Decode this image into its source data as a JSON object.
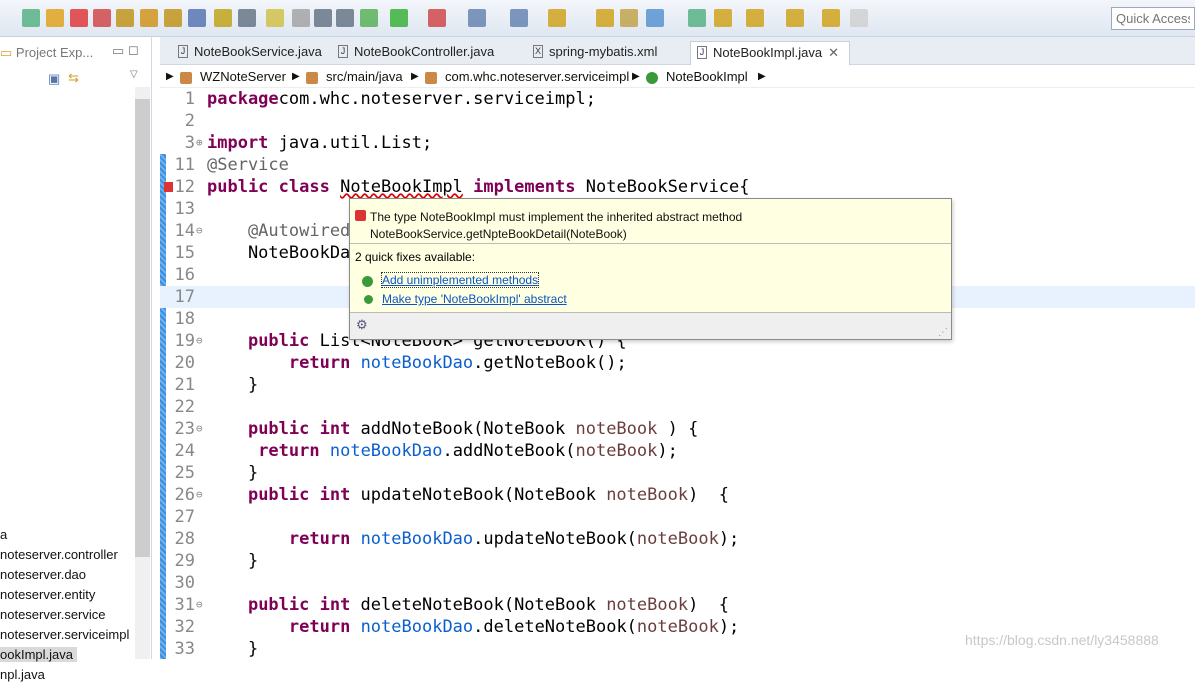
{
  "toolbar": {
    "quick_access": "Quick Access"
  },
  "left_panel": {
    "title": "Project Exp...",
    "items": [
      "a",
      "noteserver.controller",
      "noteserver.dao",
      "noteserver.entity",
      "noteserver.service",
      "noteserver.serviceimpl",
      "ookImpl.java",
      "npl.java"
    ]
  },
  "tabs": [
    {
      "label": "NoteBookService.java",
      "icon": "J"
    },
    {
      "label": "NoteBookController.java",
      "icon": "J"
    },
    {
      "label": "spring-mybatis.xml",
      "icon": "X"
    },
    {
      "label": "NoteBookImpl.java",
      "icon": "J",
      "active": true
    }
  ],
  "breadcrumb": [
    "WZNoteServer",
    "src/main/java",
    "com.whc.noteserver.serviceimpl",
    "NoteBookImpl"
  ],
  "code": [
    {
      "n": "1",
      "t": [
        [
          "kw",
          "package"
        ],
        [
          "",
          "com.whc.noteserver.serviceimpl;"
        ]
      ]
    },
    {
      "n": "2",
      "t": []
    },
    {
      "n": "3",
      "mark": "⊕",
      "t": [
        [
          "kw",
          "import"
        ],
        [
          "",
          " java.util.List;"
        ]
      ]
    },
    {
      "n": "11",
      "t": [
        [
          "ann",
          "@Service"
        ]
      ]
    },
    {
      "n": "12",
      "err": true,
      "t": [
        [
          "kw",
          "public class"
        ],
        [
          "",
          " "
        ],
        [
          "err",
          "NoteBookImpl"
        ],
        [
          "",
          " "
        ],
        [
          "kw",
          "implements"
        ],
        [
          "",
          " NoteBookService{"
        ]
      ]
    },
    {
      "n": "13",
      "t": []
    },
    {
      "n": "14",
      "mark": "⊖",
      "t": [
        [
          "ann",
          "    @Autowired"
        ]
      ]
    },
    {
      "n": "15",
      "t": [
        [
          "",
          "    NoteBookDao "
        ],
        [
          "fld",
          "noteBookDao"
        ],
        [
          "",
          ";"
        ]
      ]
    },
    {
      "n": "16",
      "t": []
    },
    {
      "n": "17",
      "cur": true,
      "t": []
    },
    {
      "n": "18",
      "t": []
    },
    {
      "n": "19",
      "mark": "⊖",
      "t": [
        [
          "",
          "    "
        ],
        [
          "kw",
          "public"
        ],
        [
          "",
          " List<NoteBook> getNoteBook() {"
        ]
      ]
    },
    {
      "n": "20",
      "t": [
        [
          "",
          "        "
        ],
        [
          "kw",
          "return"
        ],
        [
          "",
          " "
        ],
        [
          "fld",
          "noteBookDao"
        ],
        [
          "",
          ".getNoteBook();"
        ]
      ]
    },
    {
      "n": "21",
      "t": [
        [
          "",
          "    }"
        ]
      ]
    },
    {
      "n": "22",
      "t": []
    },
    {
      "n": "23",
      "mark": "⊖",
      "t": [
        [
          "",
          "    "
        ],
        [
          "kw",
          "public int"
        ],
        [
          "",
          " addNoteBook(NoteBook "
        ],
        [
          "par",
          "noteBook"
        ],
        [
          "",
          " ) {"
        ]
      ]
    },
    {
      "n": "24",
      "t": [
        [
          "",
          "     "
        ],
        [
          "kw",
          "return"
        ],
        [
          "",
          " "
        ],
        [
          "fld",
          "noteBookDao"
        ],
        [
          "",
          ".addNoteBook("
        ],
        [
          "par",
          "noteBook"
        ],
        [
          "",
          ");"
        ]
      ]
    },
    {
      "n": "25",
      "t": [
        [
          "",
          "    }"
        ]
      ]
    },
    {
      "n": "26",
      "mark": "⊖",
      "t": [
        [
          "",
          "    "
        ],
        [
          "kw",
          "public int"
        ],
        [
          "",
          " updateNoteBook(NoteBook "
        ],
        [
          "par",
          "noteBook"
        ],
        [
          "",
          ")  {"
        ]
      ]
    },
    {
      "n": "27",
      "t": []
    },
    {
      "n": "28",
      "t": [
        [
          "",
          "        "
        ],
        [
          "kw",
          "return"
        ],
        [
          "",
          " "
        ],
        [
          "fld",
          "noteBookDao"
        ],
        [
          "",
          ".updateNoteBook("
        ],
        [
          "par",
          "noteBook"
        ],
        [
          "",
          ");"
        ]
      ]
    },
    {
      "n": "29",
      "t": [
        [
          "",
          "    }"
        ]
      ]
    },
    {
      "n": "30",
      "t": []
    },
    {
      "n": "31",
      "mark": "⊖",
      "t": [
        [
          "",
          "    "
        ],
        [
          "kw",
          "public int"
        ],
        [
          "",
          " deleteNoteBook(NoteBook "
        ],
        [
          "par",
          "noteBook"
        ],
        [
          "",
          ")  {"
        ]
      ]
    },
    {
      "n": "32",
      "t": [
        [
          "",
          "        "
        ],
        [
          "kw",
          "return"
        ],
        [
          "",
          " "
        ],
        [
          "fld",
          "noteBookDao"
        ],
        [
          "",
          ".deleteNoteBook("
        ],
        [
          "par",
          "noteBook"
        ],
        [
          "",
          ");"
        ]
      ]
    },
    {
      "n": "33",
      "t": [
        [
          "",
          "    }"
        ]
      ]
    }
  ],
  "popup": {
    "message_line1": "The type NoteBookImpl must implement the inherited abstract method",
    "message_line2": "NoteBookService.getNpteBookDetail(NoteBook)",
    "fixes_count": "2 quick fixes available:",
    "fixes": [
      "Add unimplemented methods",
      "Make type 'NoteBookImpl' abstract"
    ]
  },
  "watermark": "https://blog.csdn.net/ly3458888"
}
